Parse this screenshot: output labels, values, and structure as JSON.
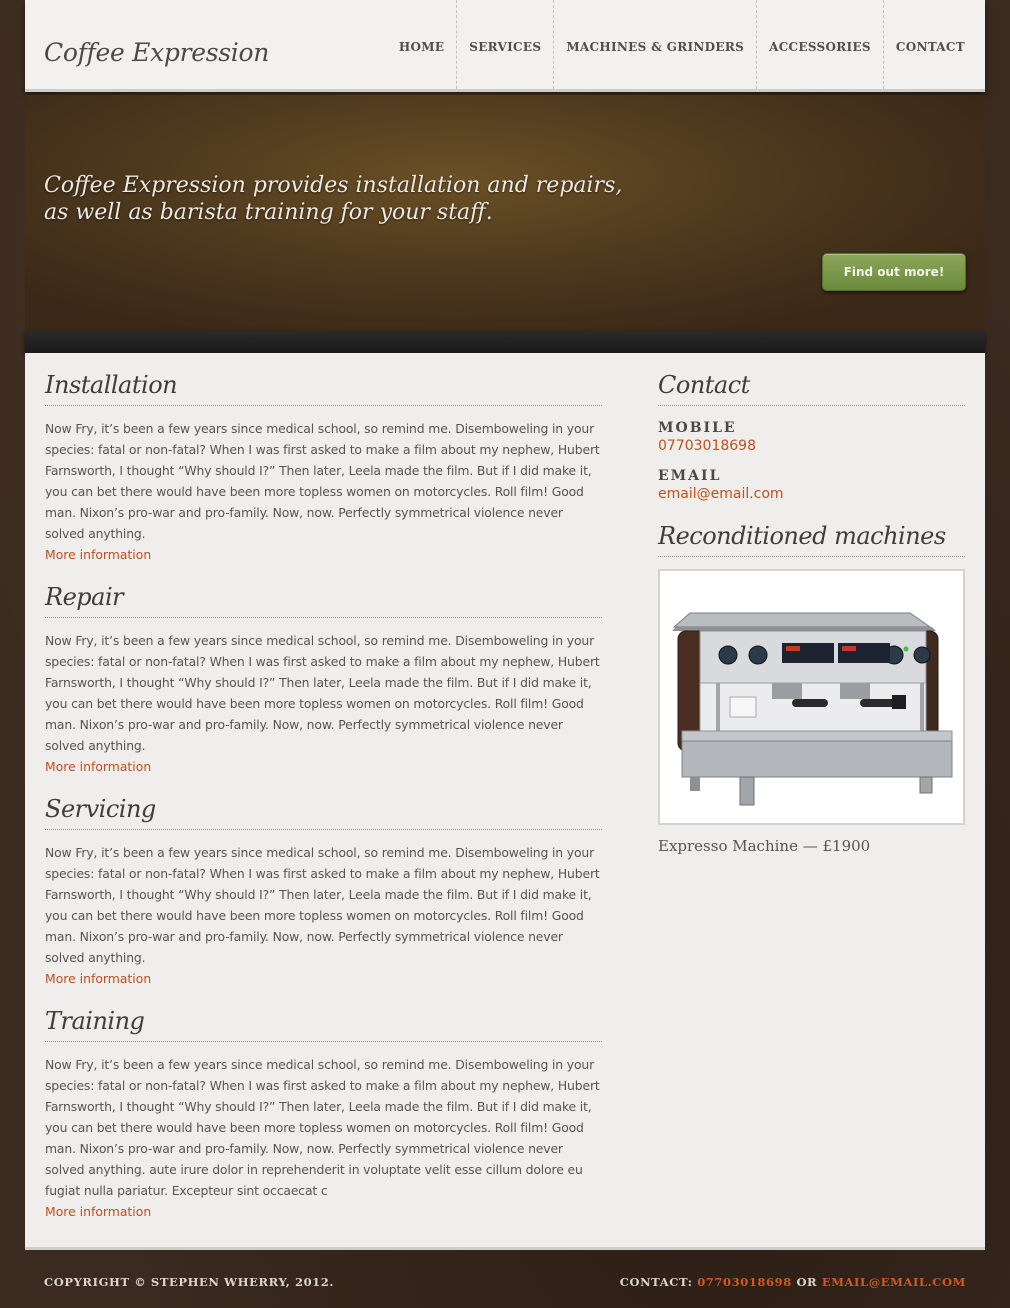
{
  "header": {
    "logo": "Coffee Expression",
    "nav": [
      "HOME",
      "SERVICES",
      "MACHINES & GRINDERS",
      "ACCESSORIES",
      "CONTACT"
    ]
  },
  "hero": {
    "text_line1": "Coffee Expression provides installation and repairs,",
    "text_line2": "as well as barista training for your staff.",
    "button": "Find out more!"
  },
  "sections": [
    {
      "title": "Installation",
      "body": "Now Fry, it’s been a few years since medical school, so remind me. Disemboweling in your species: fatal or non-fatal? When I was first asked to make a film about my nephew, Hubert Farnsworth, I thought “Why should I?” Then later, Leela made the film. But if I did make it, you can bet there would have been more topless women on motorcycles. Roll film! Good man. Nixon’s pro-war and pro-family. Now, now. Perfectly symmetrical violence never solved anything.",
      "link": "More information"
    },
    {
      "title": "Repair",
      "body": "Now Fry, it’s been a few years since medical school, so remind me. Disemboweling in your species: fatal or non-fatal? When I was first asked to make a film about my nephew, Hubert Farnsworth, I thought “Why should I?” Then later, Leela made the film. But if I did make it, you can bet there would have been more topless women on motorcycles. Roll film! Good man. Nixon’s pro-war and pro-family. Now, now. Perfectly symmetrical violence never solved anything.",
      "link": "More information"
    },
    {
      "title": "Servicing",
      "body": "Now Fry, it’s been a few years since medical school, so remind me. Disemboweling in your species: fatal or non-fatal? When I was first asked to make a film about my nephew, Hubert Farnsworth, I thought “Why should I?” Then later, Leela made the film. But if I did make it, you can bet there would have been more topless women on motorcycles. Roll film! Good man. Nixon’s pro-war and pro-family. Now, now. Perfectly symmetrical violence never solved anything.",
      "link": "More information"
    },
    {
      "title": "Training",
      "body": "Now Fry, it’s been a few years since medical school, so remind me. Disemboweling in your species: fatal or non-fatal? When I was first asked to make a film about my nephew, Hubert Farnsworth, I thought “Why should I?” Then later, Leela made the film. But if I did make it, you can bet there would have been more topless women on motorcycles. Roll film! Good man. Nixon’s pro-war and pro-family. Now, now. Perfectly symmetrical violence never solved anything. aute irure dolor in reprehenderit in voluptate velit esse cillum dolore eu fugiat nulla pariatur. Excepteur sint occaecat c",
      "link": "More information"
    }
  ],
  "contact": {
    "title": "Contact",
    "mobile_label": "MOBILE",
    "mobile": "07703018698",
    "email_label": "EMAIL",
    "email": "email@email.com"
  },
  "reconditioned": {
    "title": "Reconditioned machines",
    "caption": "Expresso Machine — £1900"
  },
  "footer": {
    "copyright": "COPYRIGHT © STEPHEN WHERRY, 2012.",
    "contact_label": "CONTACT:",
    "phone": "07703018698",
    "or": "OR",
    "email": "EMAIL@EMAIL.COM"
  },
  "colors": {
    "accent": "#c0501e",
    "button_green": "#7a9a4a",
    "background_brown": "#3a2a20"
  }
}
